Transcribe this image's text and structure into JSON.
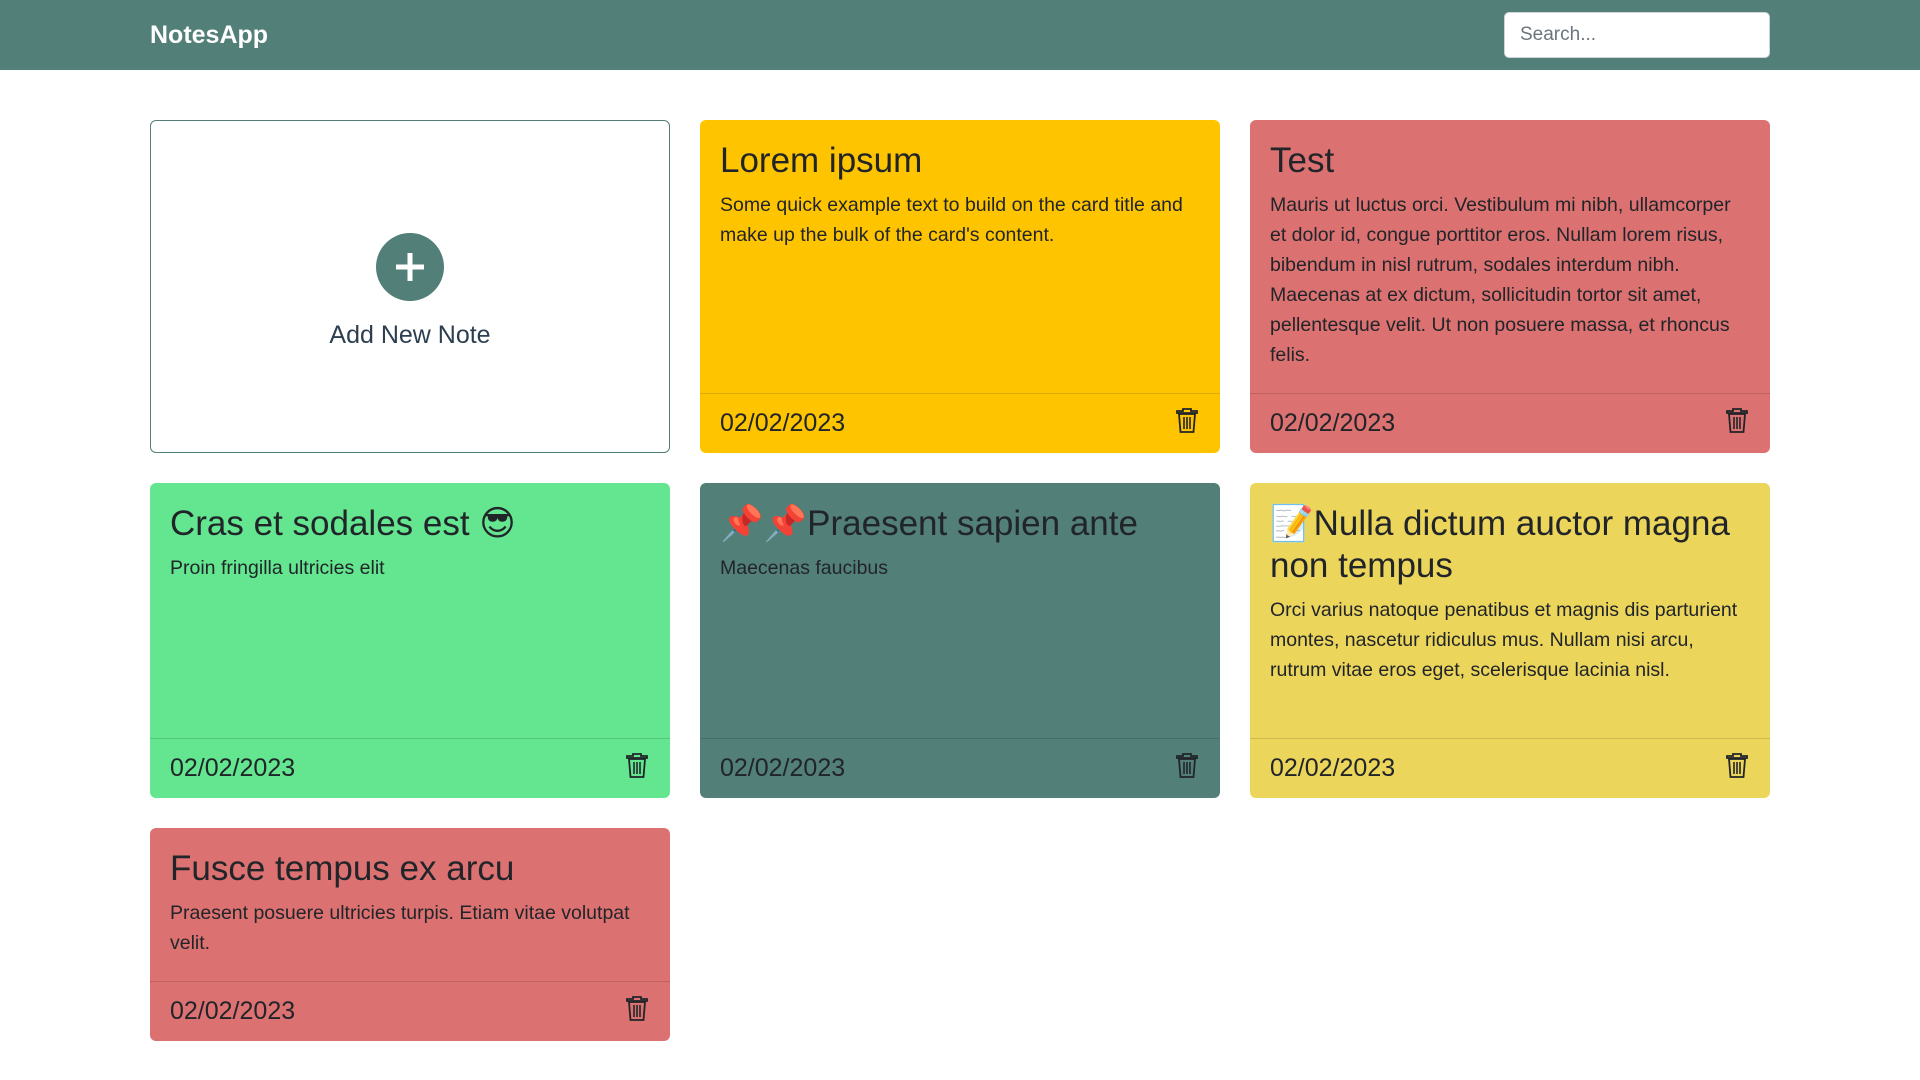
{
  "app": {
    "brand": "NotesApp",
    "search_placeholder": "Search..."
  },
  "add_note": {
    "label": "Add New Note"
  },
  "colors": {
    "navbar": "#527f78",
    "yellow": "#ffc400",
    "red": "#dc7171",
    "green": "#63e68f",
    "teal": "#527f78",
    "light_yellow": "#ecd55b"
  },
  "notes": [
    {
      "title": "Lorem ipsum",
      "text": "Some quick example text to build on the card title and make up the bulk of the card's content.",
      "date": "02/02/2023",
      "color": "yellow"
    },
    {
      "title": "Test",
      "text": "Mauris ut luctus orci. Vestibulum mi nibh, ullamcorper et dolor id, congue porttitor eros. Nullam lorem risus, bibendum in nisl rutrum, sodales interdum nibh. Maecenas at ex dictum, sollicitudin tortor sit amet, pellentesque velit. Ut non posuere massa, et rhoncus felis.",
      "date": "02/02/2023",
      "color": "red"
    },
    {
      "title": "Cras et sodales est 😎",
      "text": "Proin fringilla ultricies elit",
      "date": "02/02/2023",
      "color": "green"
    },
    {
      "title": "📌📌Praesent sapien ante",
      "text": "Maecenas faucibus",
      "date": "02/02/2023",
      "color": "teal"
    },
    {
      "title": "📝Nulla dictum auctor magna non tempus",
      "text": "Orci varius natoque penatibus et magnis dis parturient montes, nascetur ridiculus mus. Nullam nisi arcu, rutrum vitae eros eget, scelerisque lacinia nisl.",
      "date": "02/02/2023",
      "color": "light_yellow"
    },
    {
      "title": "Fusce tempus ex arcu",
      "text": "Praesent posuere ultricies turpis. Etiam vitae volutpat velit.",
      "date": "02/02/2023",
      "color": "red"
    }
  ]
}
